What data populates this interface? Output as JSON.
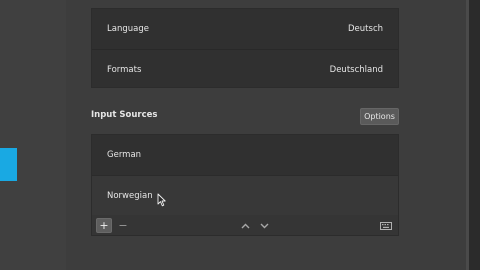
{
  "region": {
    "rows": [
      {
        "label": "Language",
        "value": "Deutsch"
      },
      {
        "label": "Formats",
        "value": "Deutschland"
      }
    ]
  },
  "input_sources": {
    "title": "Input Sources",
    "options_label": "Options",
    "items": [
      "German",
      "Norwegian"
    ],
    "toolbar": {
      "add": "+",
      "remove": "−",
      "icons": [
        "plus-icon",
        "minus-icon",
        "chevron-up-icon",
        "chevron-down-icon",
        "keyboard-icon"
      ]
    }
  },
  "colors": {
    "accent": "#19a9e3",
    "panel": "#303030",
    "background": "#3d3d3d"
  }
}
